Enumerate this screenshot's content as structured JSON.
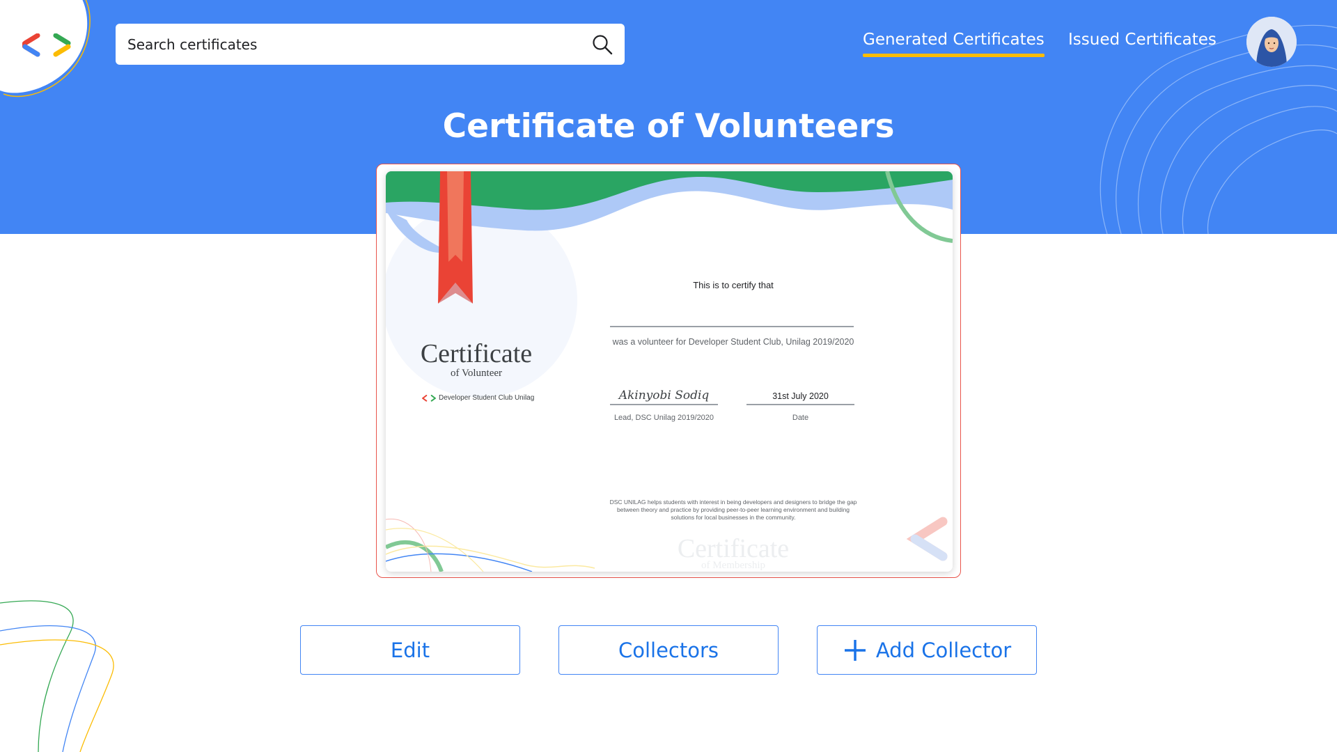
{
  "header": {
    "search": {
      "placeholder": "Search certificates",
      "icon": "search-icon"
    },
    "nav": {
      "generated": "Generated Certificates",
      "issued": "Issued Certificates",
      "active": "generated"
    },
    "avatar_icon": "avatar",
    "accent_underline_color": "#fbbc04",
    "background_color": "#4285f4"
  },
  "page": {
    "title": "Certificate of Volunteers"
  },
  "certificate": {
    "heading": "Certificate",
    "subheading": "of Volunteer",
    "club": "Developer Student Club Unilag",
    "certify_text": "This is to certify that",
    "volunteer_text": "was a volunteer for Developer Student Club, Unilag 2019/2020",
    "signature": "Akinyobi Sodiq",
    "signature_title": "Lead, DSC Unilag 2019/2020",
    "date_value": "31st July 2020",
    "date_label": "Date",
    "about": "DSC UNILAG helps students with interest in being developers and designers to bridge the gap between theory and practice by providing peer-to-peer learning environment and building solutions for local businesses in the community.",
    "watermark_heading": "Certificate",
    "watermark_subheading": "of Membership",
    "ribbon_color": "#ea4335",
    "frame_color": "#e8534a"
  },
  "actions": {
    "edit": "Edit",
    "collectors": "Collectors",
    "add_collector": "Add Collector",
    "add_icon": "plus-icon",
    "button_color": "#1a73e8"
  }
}
